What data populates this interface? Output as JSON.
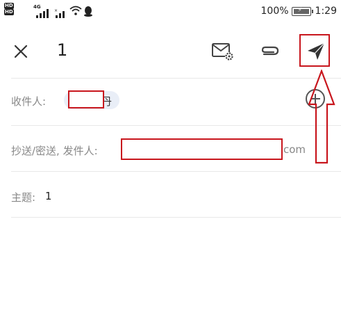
{
  "status_bar": {
    "hd_top": "HD",
    "hd_bottom": "HD",
    "signal_label": "4G",
    "battery_text": "100%",
    "battery_level": 1.0,
    "time": "1:29"
  },
  "toolbar": {
    "draft_count": "1",
    "icons": {
      "close": "close-icon",
      "settings": "mail-settings-icon",
      "attach": "paperclip-icon",
      "send": "send-icon"
    }
  },
  "recipient": {
    "label": "收件人:",
    "chip_text": "丹"
  },
  "cc": {
    "label": "抄送/密送, 发件人:",
    "suffix": "com"
  },
  "subject": {
    "label": "主题:",
    "value": "1"
  },
  "colors": {
    "annotation_red": "#c8161d",
    "chip_bg": "#e9eef7"
  }
}
